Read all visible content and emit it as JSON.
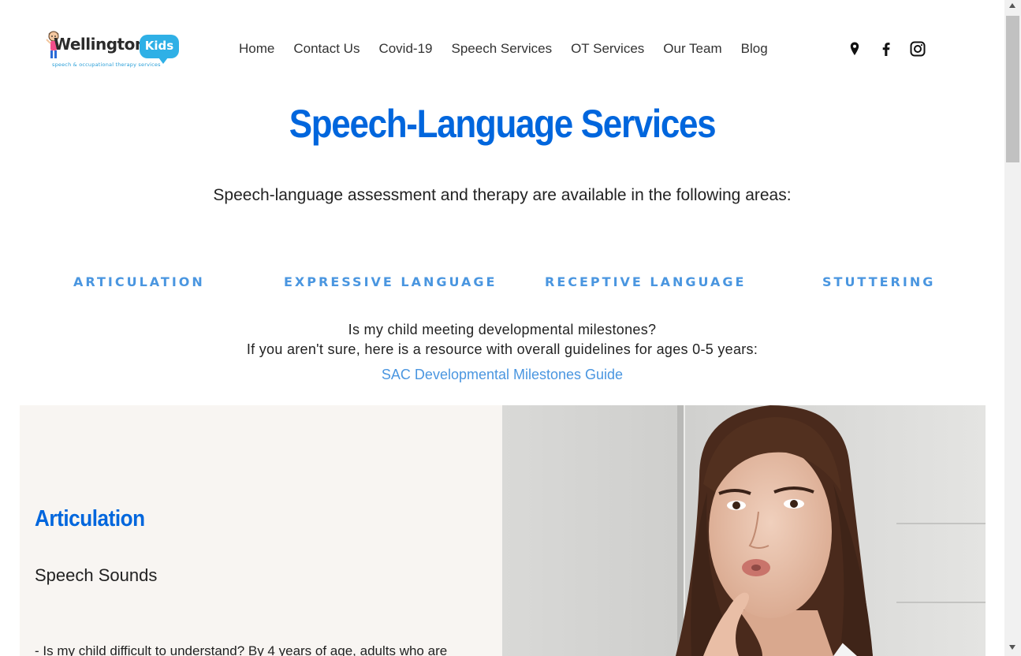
{
  "header": {
    "logo": {
      "wordmark": "Wellington",
      "bubble_text": "Kids",
      "tagline": "speech & occupational therapy services"
    },
    "nav": [
      "Home",
      "Contact Us",
      "Covid-19",
      "Speech Services",
      "OT Services",
      "Our Team",
      "Blog"
    ],
    "social_icons": [
      "map-pin-icon",
      "facebook-icon",
      "instagram-icon"
    ]
  },
  "main": {
    "title": "Speech-Language Services",
    "intro": "Speech-language assessment and therapy are available in the following areas:",
    "areas": [
      "Articulation",
      "Expressive Language",
      "Receptive Language",
      "Stuttering"
    ],
    "milestone_question": "Is my child meeting developmental milestones?",
    "milestone_note": "If you aren't sure, here is a resource with overall guidelines for ages 0-5 years:",
    "guide_link": "SAC Developmental Milestones Guide"
  },
  "articulation_section": {
    "title": "Articulation",
    "subtitle": "Speech Sounds",
    "body": "- Is my child difficult to understand? By 4 years of age, adults who are"
  },
  "colors": {
    "brand_blue": "#0066dd",
    "accent_blue": "#4a96e0",
    "panel_bg": "#f8f5f2",
    "logo_bubble": "#2fb0e6"
  }
}
